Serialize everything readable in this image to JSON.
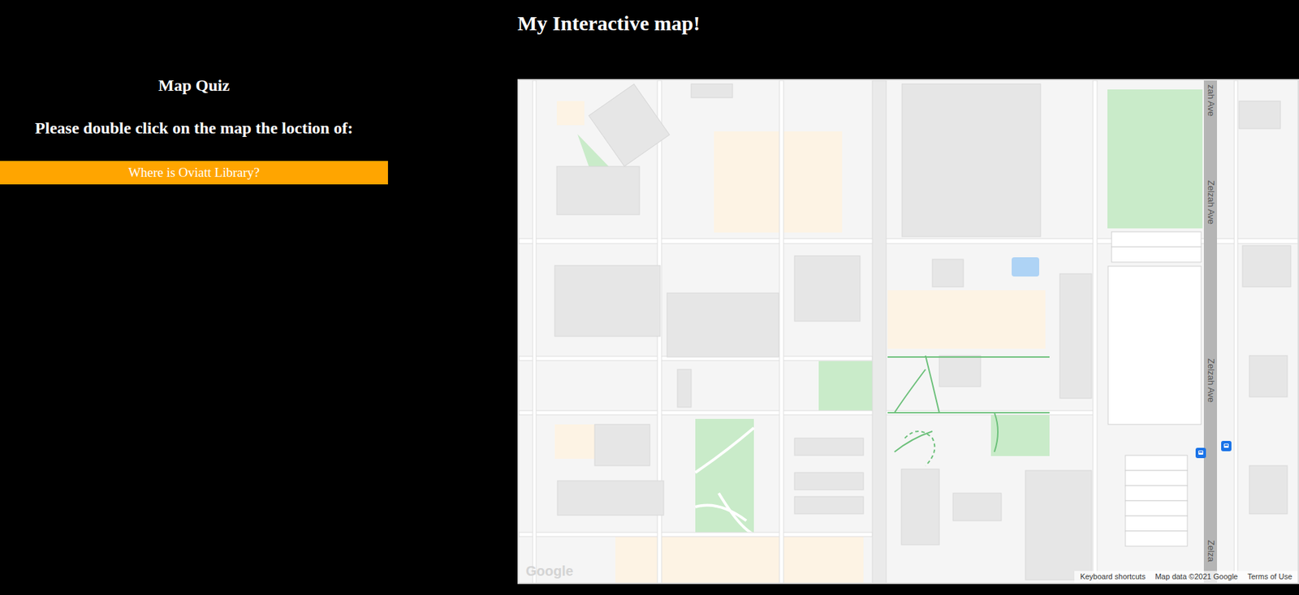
{
  "page": {
    "title": "My Interactive map!"
  },
  "quiz": {
    "heading": "Map Quiz",
    "prompt": "Please double click on the map the loction of:",
    "question": "Where is Oviatt Library?"
  },
  "map": {
    "street_labels": [
      "zah Ave",
      "Zelzah Ave",
      "Zelzah Ave",
      "Zelza"
    ],
    "logo": "Google",
    "footer": [
      "Keyboard shortcuts",
      "Map data ©2021 Google",
      "Terms of Use"
    ]
  }
}
